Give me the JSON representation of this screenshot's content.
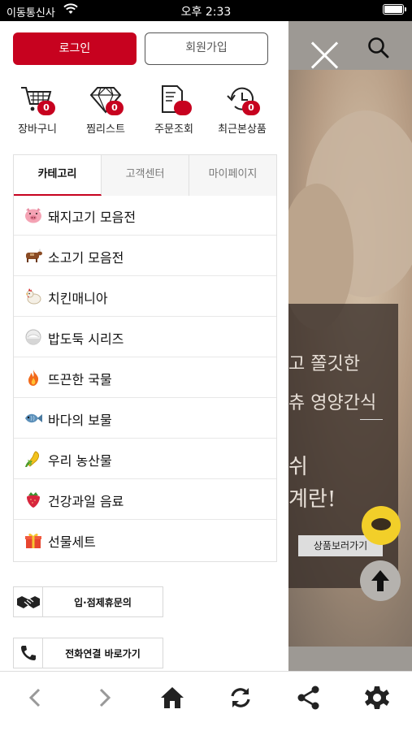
{
  "status_bar": {
    "carrier": "이동통신사",
    "time": "오후 2:33"
  },
  "auth": {
    "login_label": "로그인",
    "join_label": "회원가입"
  },
  "quick_links": [
    {
      "label": "장바구니",
      "icon": "cart-icon",
      "badge": "0"
    },
    {
      "label": "찜리스트",
      "icon": "diamond-icon",
      "badge": "0"
    },
    {
      "label": "주문조회",
      "icon": "receipt-icon",
      "badge": ""
    },
    {
      "label": "최근본상품",
      "icon": "history-icon",
      "badge": "0"
    }
  ],
  "tabs": [
    {
      "label": "카테고리",
      "active": true
    },
    {
      "label": "고객센터",
      "active": false
    },
    {
      "label": "마이페이지",
      "active": false
    }
  ],
  "categories": [
    {
      "label": "돼지고기 모음전",
      "icon": "pig-icon"
    },
    {
      "label": "소고기 모음전",
      "icon": "cow-icon"
    },
    {
      "label": "치킨매니아",
      "icon": "chicken-icon"
    },
    {
      "label": "밥도둑 시리즈",
      "icon": "rice-bowl-icon"
    },
    {
      "label": "뜨끈한 국물",
      "icon": "fire-icon"
    },
    {
      "label": "바다의 보물",
      "icon": "fish-icon"
    },
    {
      "label": "우리 농산물",
      "icon": "corn-icon"
    },
    {
      "label": "건강과일 음료",
      "icon": "strawberry-icon"
    },
    {
      "label": "선물세트",
      "icon": "gift-icon"
    }
  ],
  "extras": [
    {
      "label": "입·점제휴문의",
      "icon": "handshake-icon"
    },
    {
      "label": "전화연결 바로가기",
      "icon": "phone-icon"
    }
  ],
  "background_page": {
    "promo_line1": "고 쫄깃한",
    "promo_line2": "츄 영양간식",
    "promo_line3": "쉬",
    "promo_line4": "계란!",
    "view_product_label": "상품보러가기"
  },
  "toolbar": [
    "back-icon",
    "forward-icon",
    "home-icon",
    "refresh-icon",
    "share-icon",
    "settings-icon"
  ],
  "colors": {
    "brand": "#c7021f",
    "overlay": "#9d9994"
  }
}
